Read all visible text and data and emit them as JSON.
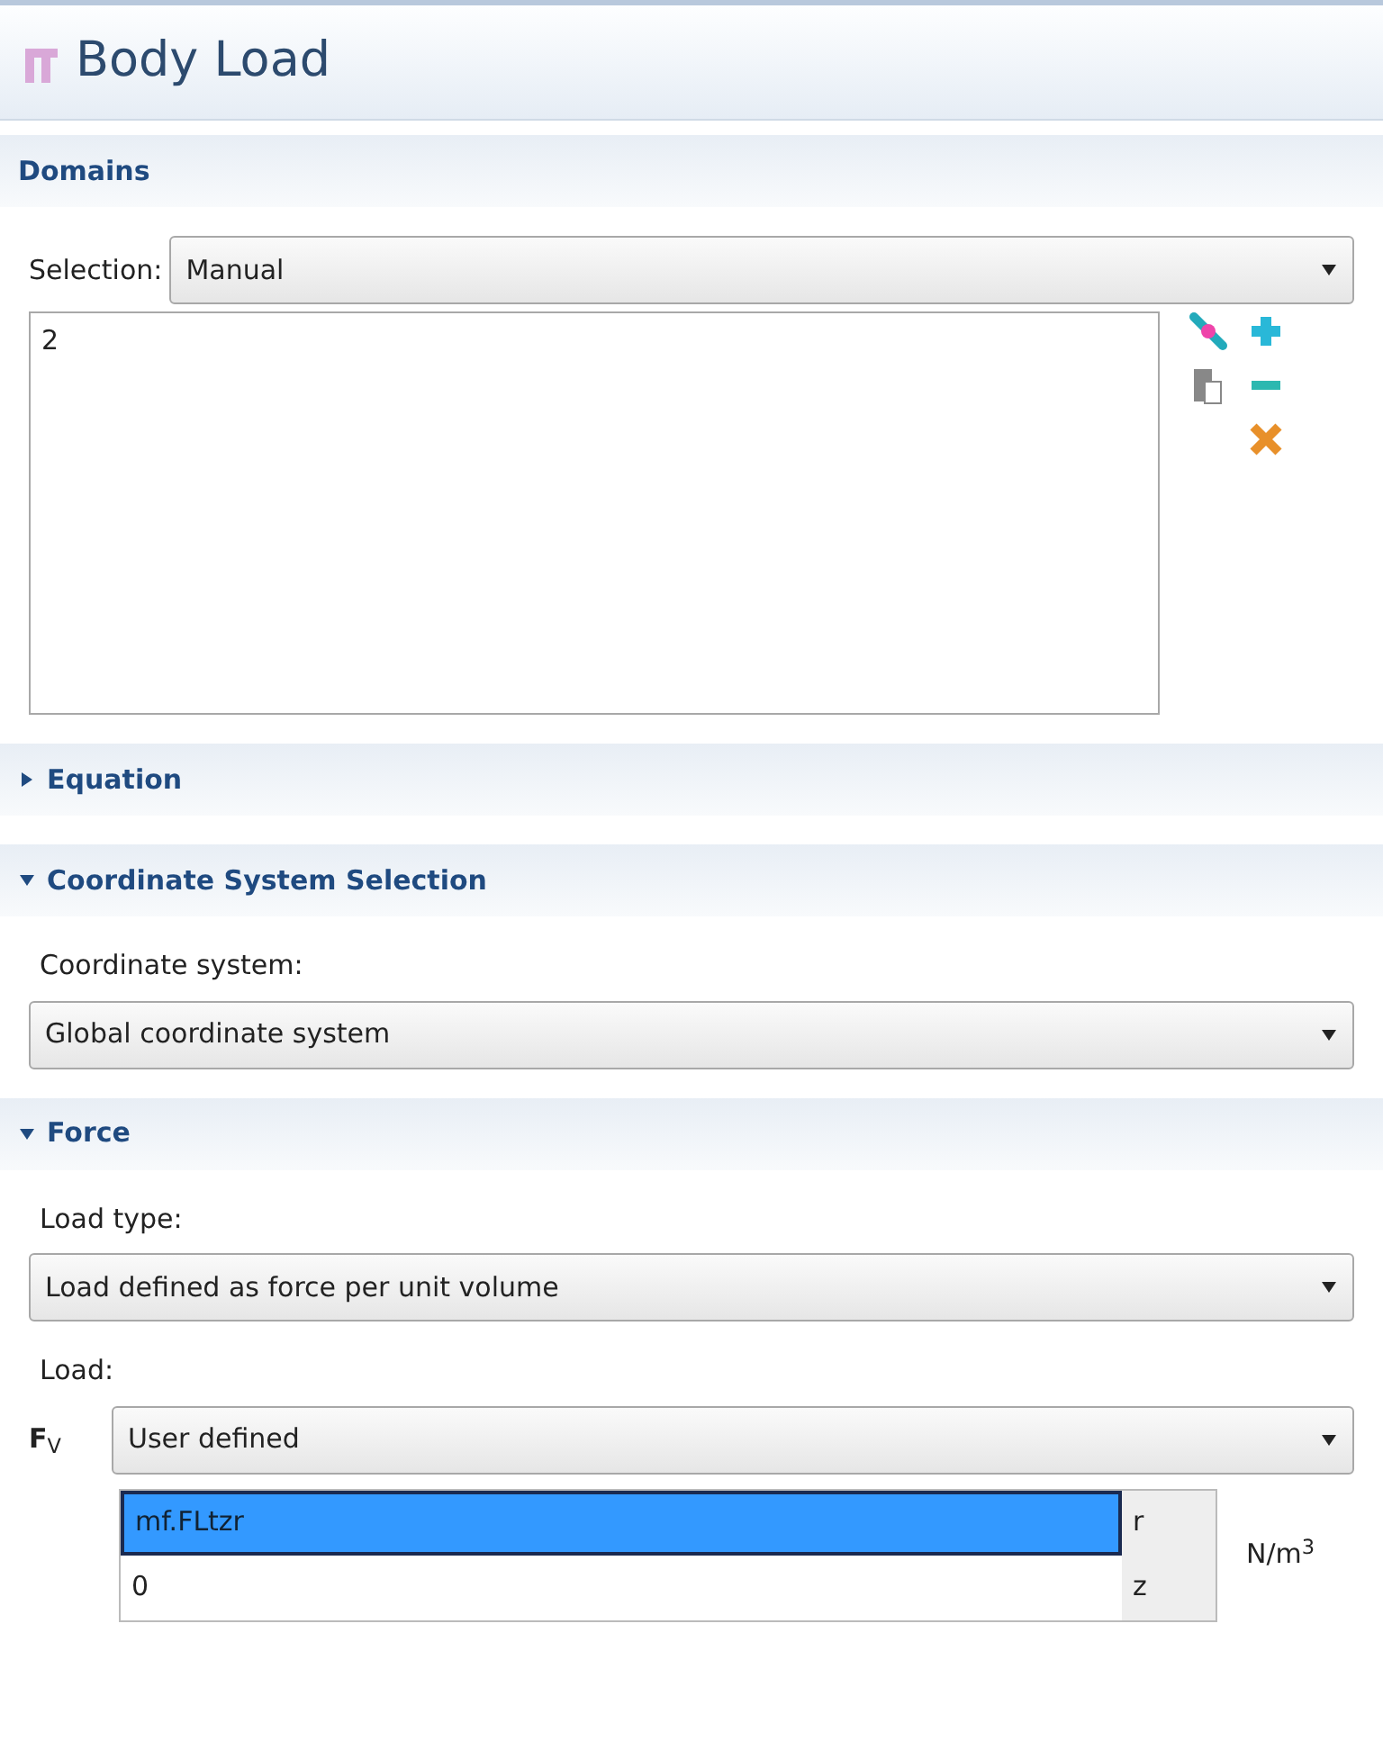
{
  "title": "Body Load",
  "domains": {
    "heading": "Domains",
    "selection_label": "Selection:",
    "selection_value": "Manual",
    "list_items": [
      "2"
    ]
  },
  "sections": [
    {
      "heading": "Equation",
      "expanded": false
    },
    {
      "heading": "Coordinate System Selection",
      "expanded": true,
      "fields": [
        {
          "label": "Coordinate system:",
          "value": "Global coordinate system"
        }
      ]
    },
    {
      "heading": "Force",
      "expanded": true,
      "fields": [
        {
          "label": "Load type:",
          "value": "Load defined as force per unit volume"
        },
        {
          "label": "Load:"
        }
      ],
      "load": {
        "symbol": "**F**$_{V}$",
        "value": "User defined",
        "unit": "N/m$^{3}$",
        "components": [
          {
            "value": "mf.FLtzr",
            "axis": "r",
            "selected": true
          },
          {
            "value": "0",
            "axis": "z",
            "selected": false
          }
        ]
      }
    }
  ]
}
